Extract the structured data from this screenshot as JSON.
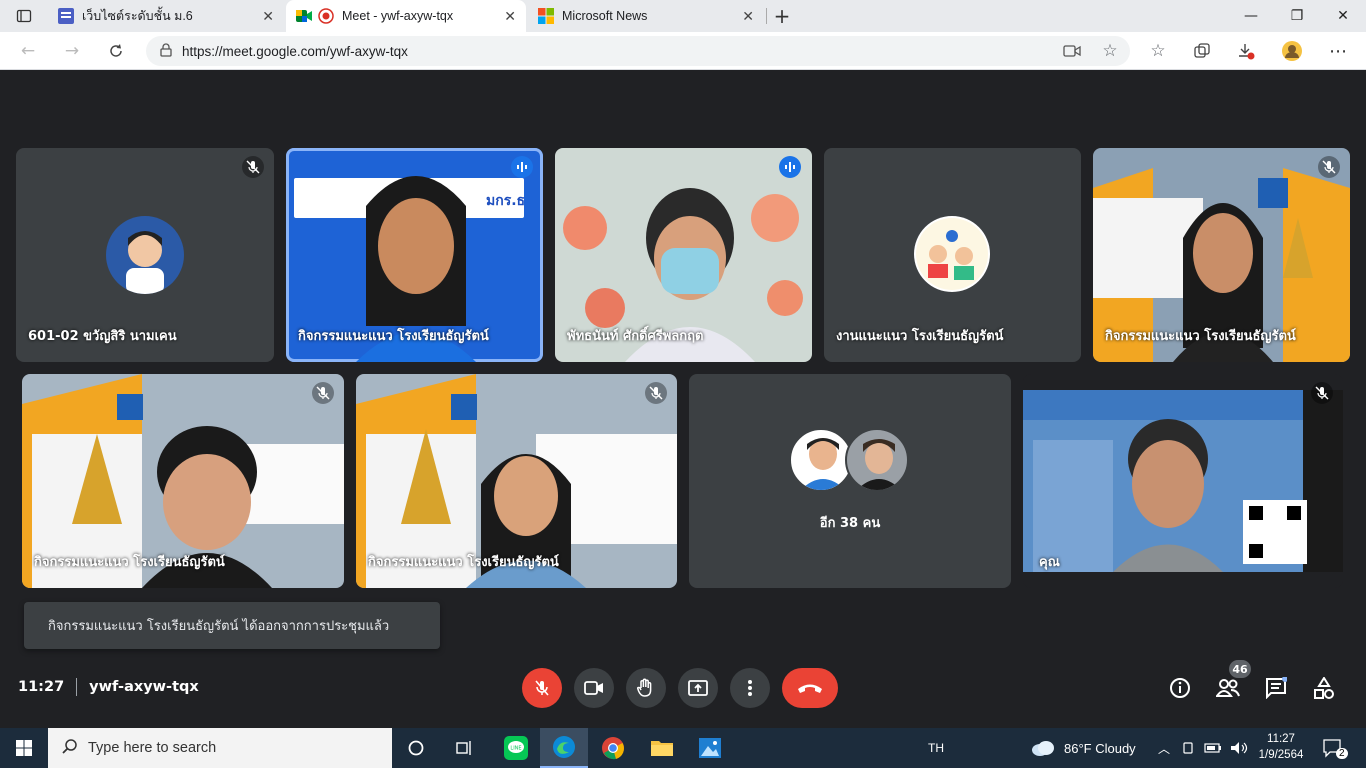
{
  "browser": {
    "tabs": [
      {
        "title": "เว็บไซต์ระดับชั้น ม.6",
        "active": false
      },
      {
        "title": "Meet - ywf-axyw-tqx",
        "active": true
      },
      {
        "title": "Microsoft News",
        "active": false
      }
    ],
    "url": "https://meet.google.com/ywf-axyw-tqx"
  },
  "meet": {
    "participants": [
      {
        "name": "601-02 ขวัญสิริ นามเคน",
        "mic": "muted",
        "kind": "avatar"
      },
      {
        "name": "กิจกรรมแนะแนว โรงเรียนธัญรัตน์",
        "mic": "speaking",
        "kind": "video",
        "banner": "มกร.ธ"
      },
      {
        "name": "พัทธนันท์ ศักดิ์ศรีพลกฤต",
        "mic": "speaking",
        "kind": "video"
      },
      {
        "name": "งานแนะแนว โรงเรียนธัญรัตน์",
        "mic": "none",
        "kind": "avatar"
      },
      {
        "name": "กิจกรรมแนะแนว โรงเรียนธัญรัตน์",
        "mic": "muted",
        "kind": "video"
      },
      {
        "name": "กิจกรรมแนะแนว โรงเรียนธัญรัตน์",
        "mic": "muted",
        "kind": "video"
      },
      {
        "name": "กิจกรรมแนะแนว โรงเรียนธัญรัตน์",
        "mic": "muted",
        "kind": "video"
      },
      {
        "name": "อีก 38 คน",
        "mic": "none",
        "kind": "others"
      },
      {
        "name": "คุณ",
        "mic": "muted",
        "kind": "self"
      }
    ],
    "toast": "กิจกรรมแนะแนว โรงเรียนธัญรัตน์ ได้ออกจากการประชุมแล้ว",
    "time": "11:27",
    "code": "ywf-axyw-tqx",
    "participant_count": "46"
  },
  "taskbar": {
    "search_placeholder": "Type here to search",
    "lang": "TH",
    "weather": "86°F  Cloudy",
    "time": "11:27",
    "date": "1/9/2564",
    "notifications": "2"
  }
}
